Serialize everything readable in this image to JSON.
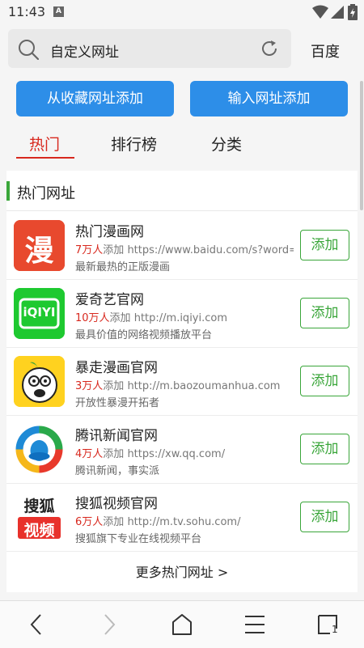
{
  "status": {
    "time": "11:43",
    "notif": "A"
  },
  "search": {
    "text": "自定义网址",
    "engine": "百度"
  },
  "buttons": {
    "add_from_fav": "从收藏网址添加",
    "add_by_url": "输入网址添加"
  },
  "tabs": [
    {
      "label": "热门"
    },
    {
      "label": "排行榜"
    },
    {
      "label": "分类"
    }
  ],
  "section": {
    "title": "热门网址",
    "more": "更多热门网址 >",
    "items": [
      {
        "name": "热门漫画网",
        "count": "7万人",
        "added": "添加",
        "url": "https://www.baidu.com/s?word=%E",
        "desc": "最新最热的正版漫画",
        "action": "添加",
        "logo_text": "漫"
      },
      {
        "name": "爱奇艺官网",
        "count": "10万人",
        "added": "添加",
        "url": "http://m.iqiyi.com",
        "desc": "最具价值的网络视频播放平台",
        "action": "添加",
        "logo_text": "iQIYI"
      },
      {
        "name": "暴走漫画官网",
        "count": "3万人",
        "added": "添加",
        "url": "http://m.baozoumanhua.com",
        "desc": "开放性暴漫开拓者",
        "action": "添加"
      },
      {
        "name": "腾讯新闻官网",
        "count": "4万人",
        "added": "添加",
        "url": "https://xw.qq.com/",
        "desc": "腾讯新闻，事实派",
        "action": "添加"
      },
      {
        "name": "搜狐视频官网",
        "count": "6万人",
        "added": "添加",
        "url": "http://m.tv.sohu.com/",
        "desc": "搜狐旗下专业在线视频平台",
        "action": "添加",
        "logo_text_top": "搜狐",
        "logo_text_bottom": "视频"
      }
    ]
  },
  "nav": {
    "tabs_count": "1"
  },
  "colors": {
    "accent_blue": "#2d8ee8",
    "active_red": "#d8281e",
    "green": "#3aa63a"
  }
}
